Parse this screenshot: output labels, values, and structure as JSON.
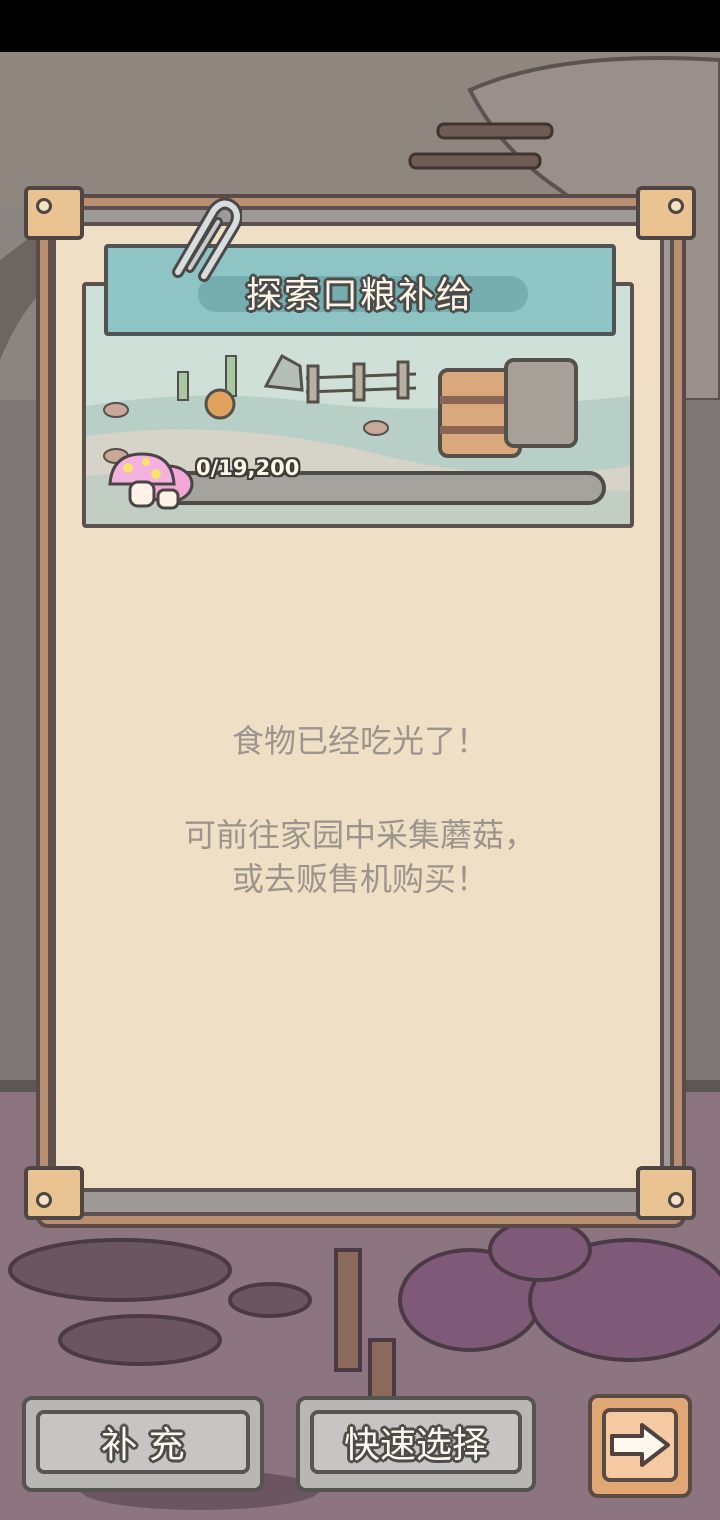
{
  "panel": {
    "title": "探索口粮补给",
    "progress_text": "0/19,200",
    "progress_current": 0,
    "progress_max": 19200
  },
  "message": {
    "line1": "食物已经吃光了！",
    "line2": "可前往家园中采集蘑菇，",
    "line3": "或去贩售机购买！"
  },
  "buttons": {
    "replenish": "补 充",
    "quick_select": "快速选择",
    "next_icon": "arrow-right-icon"
  },
  "colors": {
    "card_paper": "#efdfc5",
    "banner": "#8fc4c4",
    "accent_orange": "#e0a774"
  }
}
